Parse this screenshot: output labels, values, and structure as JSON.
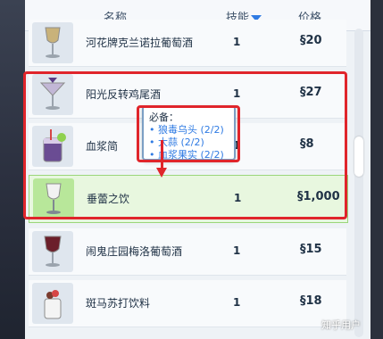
{
  "header": {
    "name_col": "名称",
    "skill_col": "技能",
    "price_col": "价格"
  },
  "currency_symbol": "§",
  "items": [
    {
      "name": "河花牌克兰诺拉葡萄酒",
      "skill": "1",
      "price": "20",
      "icon": "wine-glass-icon"
    },
    {
      "name": "阳光反转鸡尾酒",
      "skill": "1",
      "price": "27",
      "icon": "cocktail-glass-icon"
    },
    {
      "name": "血浆简",
      "skill": "1",
      "price": "8",
      "icon": "plasma-drink-icon"
    },
    {
      "name": "垂蕾之饮",
      "skill": "1",
      "price": "1,000",
      "icon": "stemmed-glass-icon"
    },
    {
      "name": "闹鬼庄园梅洛葡萄酒",
      "skill": "1",
      "price": "15",
      "icon": "red-wine-glass-icon"
    },
    {
      "name": "斑马苏打饮料",
      "skill": "1",
      "price": "18",
      "icon": "soda-cup-icon"
    }
  ],
  "tooltip": {
    "title": "必备：",
    "lines": [
      "• 狼毒乌头 (2/2)",
      "• 大蒜 (2/2)",
      "• 血浆果实 (2/2)"
    ]
  },
  "watermark": "知乎用户",
  "colors": {
    "accent_blue": "#2f7be3",
    "annotation_red": "#e0252b",
    "highlight_green": "#e8f7df"
  }
}
